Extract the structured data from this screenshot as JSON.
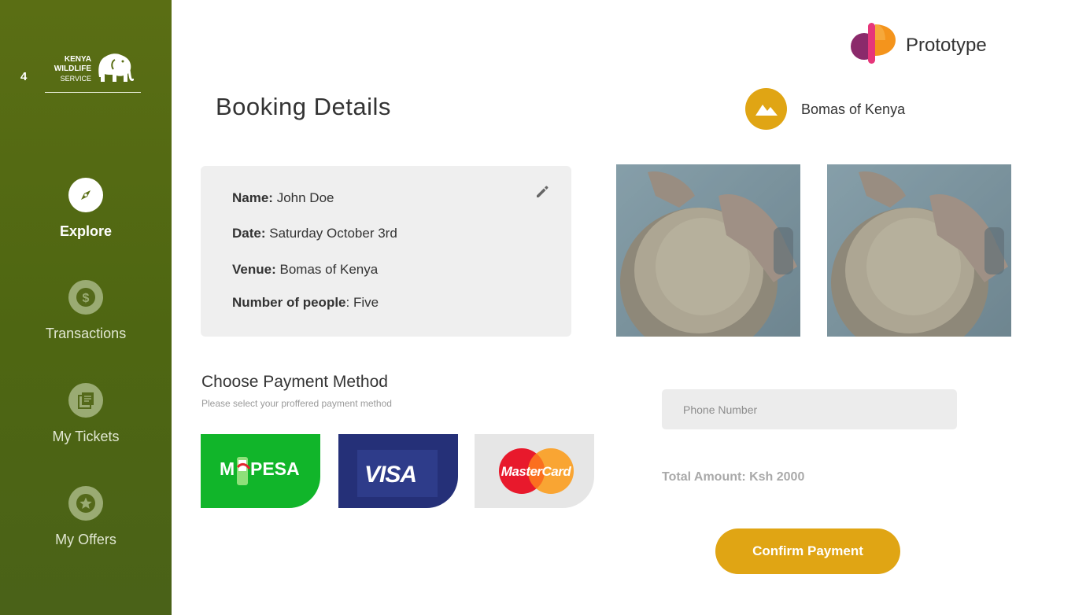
{
  "sidebar": {
    "page_number": "4",
    "logo": {
      "line1": "KENYA",
      "line2": "WILDLIFE",
      "line3": "SERVICE"
    },
    "items": [
      {
        "label": "Explore",
        "icon": "compass-icon",
        "active": true
      },
      {
        "label": "Transactions",
        "icon": "dollar-icon",
        "active": false
      },
      {
        "label": "My Tickets",
        "icon": "tickets-icon",
        "active": false
      },
      {
        "label": "My Offers",
        "icon": "star-badge-icon",
        "active": false
      }
    ]
  },
  "header": {
    "prototype_label": "Prototype"
  },
  "page": {
    "title": "Booking Details"
  },
  "venue": {
    "name": "Bomas of Kenya",
    "icon": "mountain-icon"
  },
  "booking": {
    "name_label": "Name:",
    "name_value": "John Doe",
    "date_label": "Date:",
    "date_value": "Saturday October 3rd",
    "venue_label": "Venue:",
    "venue_value": "Bomas of Kenya",
    "people_label": "Number of people",
    "people_value": ": Five"
  },
  "payment": {
    "title": "Choose Payment Method",
    "subtitle": "Please select your proffered payment method",
    "methods": [
      {
        "name": "mpesa",
        "label": "M-PESA"
      },
      {
        "name": "visa",
        "label": "VISA"
      },
      {
        "name": "mastercard",
        "label": "MasterCard"
      }
    ],
    "phone_placeholder": "Phone Number",
    "total": "Total Amount: Ksh 2000",
    "confirm_label": "Confirm Payment"
  },
  "colors": {
    "sidebar": "#5a6e14",
    "accent": "#e0a514",
    "mpesa": "#11b52a",
    "visa": "#253078",
    "card_bg": "#efefef"
  }
}
